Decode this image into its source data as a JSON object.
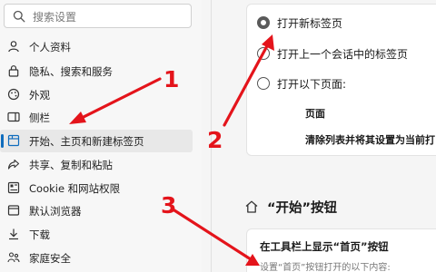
{
  "search": {
    "placeholder": "搜索设置"
  },
  "nav": [
    {
      "label": "个人资料",
      "icon": "profile-icon"
    },
    {
      "label": "隐私、搜索和服务",
      "icon": "lock-icon"
    },
    {
      "label": "外观",
      "icon": "appearance-icon"
    },
    {
      "label": "侧栏",
      "icon": "sidebar-icon"
    },
    {
      "label": "开始、主页和新建标签页",
      "icon": "home-tabs-icon",
      "active": true
    },
    {
      "label": "共享、复制和粘贴",
      "icon": "share-icon"
    },
    {
      "label": "Cookie 和网站权限",
      "icon": "cookie-icon"
    },
    {
      "label": "默认浏览器",
      "icon": "browser-icon"
    },
    {
      "label": "下载",
      "icon": "download-icon"
    },
    {
      "label": "家庭安全",
      "icon": "family-icon"
    }
  ],
  "startup": {
    "options": [
      {
        "label": "打开新标签页",
        "selected": true
      },
      {
        "label": "打开上一个会话中的标签页",
        "selected": false
      },
      {
        "label": "打开以下页面:",
        "selected": false
      }
    ],
    "column_header": "页面",
    "clear_action": "清除列表并将其设置为当前打"
  },
  "start_button_section": {
    "title": "“开始”按钮",
    "setting_title": "在工具栏上显示“首页”按钮",
    "setting_desc": "设置“首页”按钮打开的以下内容:"
  },
  "annotations": {
    "n1": "1",
    "n2": "2",
    "n3": "3"
  },
  "colors": {
    "accent": "#0f6cbd",
    "annotation": "#e4141b"
  }
}
